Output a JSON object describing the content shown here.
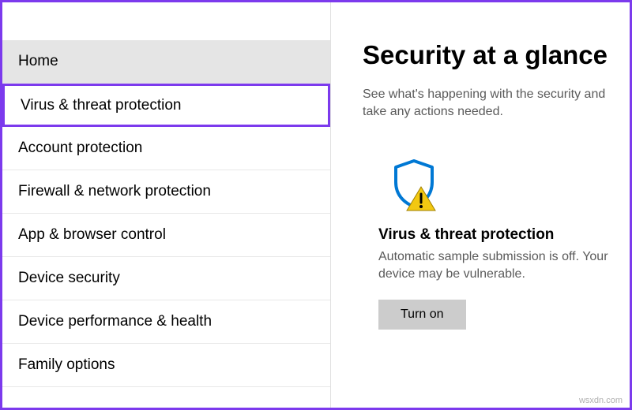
{
  "sidebar": {
    "items": [
      {
        "label": "Home"
      },
      {
        "label": "Virus & threat protection"
      },
      {
        "label": "Account protection"
      },
      {
        "label": "Firewall & network protection"
      },
      {
        "label": "App & browser control"
      },
      {
        "label": "Device security"
      },
      {
        "label": "Device performance & health"
      },
      {
        "label": "Family options"
      }
    ]
  },
  "main": {
    "title": "Security at a glance",
    "subtitle": "See what's happening with the security and take any actions needed.",
    "card": {
      "title": "Virus & threat protection",
      "description": "Automatic sample submission is off. Your device may be vulnerable.",
      "button": "Turn on"
    }
  },
  "watermark": "wsxdn.com",
  "colors": {
    "accent": "#7c3aed",
    "shield_blue": "#0078d4",
    "warning_yellow": "#f2c811"
  }
}
